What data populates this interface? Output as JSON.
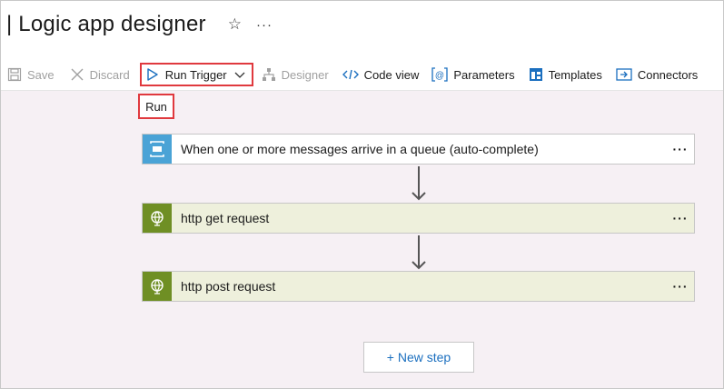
{
  "header": {
    "title": "| Logic app designer",
    "star_icon": "star-icon",
    "more_label": "···"
  },
  "toolbar": {
    "save_label": "Save",
    "discard_label": "Discard",
    "run_trigger_label": "Run Trigger",
    "designer_label": "Designer",
    "code_view_label": "Code view",
    "parameters_label": "Parameters",
    "templates_label": "Templates",
    "connectors_label": "Connectors"
  },
  "run_dropdown": {
    "item_label": "Run"
  },
  "steps": [
    {
      "label": "When one or more messages arrive in a queue (auto-complete)",
      "icon": "queue-icon",
      "more": "···"
    },
    {
      "label": "http get request",
      "icon": "globe-icon",
      "more": "···"
    },
    {
      "label": "http post request",
      "icon": "globe-icon",
      "more": "···"
    }
  ],
  "new_step_label": "+ New step",
  "colors": {
    "accent_blue": "#1b6fbf",
    "highlight_red": "#e0393e",
    "trigger_icon_bg": "#4aa3d6",
    "http_icon_bg": "#6f8f24",
    "http_card_bg": "#eef0dc",
    "canvas_bg": "#f6f0f4"
  }
}
